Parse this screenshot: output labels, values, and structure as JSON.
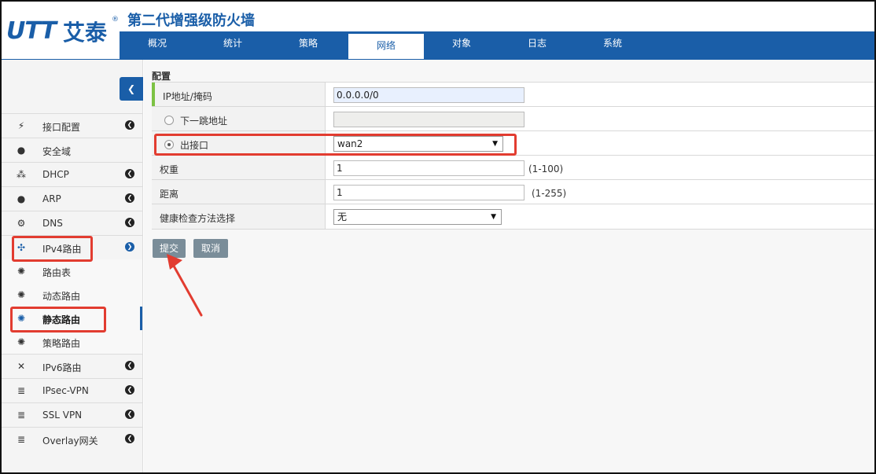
{
  "header": {
    "logo_latin": "UTT",
    "logo_cn": "艾泰",
    "logo_reg": "®",
    "product_title": "第二代增强级防火墙"
  },
  "topnav": {
    "tabs": [
      {
        "label": "概况"
      },
      {
        "label": "统计"
      },
      {
        "label": "策略"
      },
      {
        "label": "网络"
      },
      {
        "label": "对象"
      },
      {
        "label": "日志"
      },
      {
        "label": "系统"
      }
    ],
    "active": "网络"
  },
  "sidebar": {
    "items": [
      {
        "label": "接口配置",
        "icon": "plug-icon"
      },
      {
        "label": "安全域",
        "icon": "globe-icon"
      },
      {
        "label": "DHCP",
        "icon": "network-icon"
      },
      {
        "label": "ARP",
        "icon": "globe-icon"
      },
      {
        "label": "DNS",
        "icon": "gears-icon"
      },
      {
        "label": "IPv4路由",
        "icon": "move-icon"
      },
      {
        "label": "路由表",
        "icon": "gear-icon"
      },
      {
        "label": "动态路由",
        "icon": "gear-icon"
      },
      {
        "label": "静态路由",
        "icon": "gear-icon"
      },
      {
        "label": "策略路由",
        "icon": "gear-icon"
      },
      {
        "label": "IPv6路由",
        "icon": "expand-icon"
      },
      {
        "label": "IPsec-VPN",
        "icon": "list-icon"
      },
      {
        "label": "SSL VPN",
        "icon": "list-icon"
      },
      {
        "label": "Overlay网关",
        "icon": "list-icon"
      }
    ]
  },
  "form": {
    "section_title": "配置",
    "ip_mask_label": "IP地址/掩码",
    "ip_mask_value": "0.0.0.0/0",
    "next_hop_label": "下一跳地址",
    "next_hop_value": "",
    "out_iface_label": "出接口",
    "out_iface_value": "wan2",
    "weight_label": "权重",
    "weight_value": "1",
    "weight_hint": "(1-100)",
    "distance_label": "距离",
    "distance_value": "1",
    "distance_hint": "(1-255)",
    "health_label": "健康检查方法选择",
    "health_value": "无",
    "submit_label": "提交",
    "cancel_label": "取消"
  },
  "colors": {
    "brand_blue": "#1a5ea8",
    "annotation_red": "#e23c30",
    "button_gray": "#7a8d99"
  }
}
